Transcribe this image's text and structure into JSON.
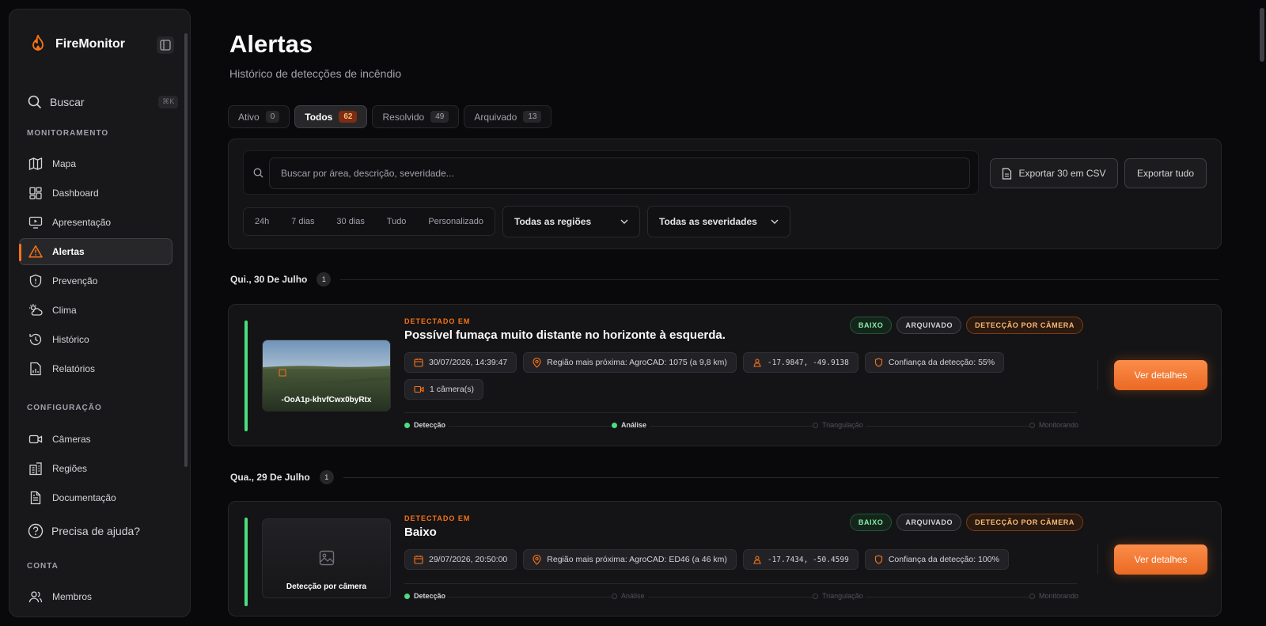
{
  "app": {
    "name": "FireMonitor"
  },
  "colors": {
    "accent": "#f97316",
    "success": "#4ade80",
    "background": "#09090b"
  },
  "sidebar": {
    "search": {
      "label": "Buscar",
      "shortcut": "⌘K"
    },
    "sections": {
      "monitoring": "MONITORAMENTO",
      "config": "CONFIGURAÇÃO",
      "account": "CONTA"
    },
    "monitoring_items": [
      {
        "label": "Mapa",
        "icon": "map-icon"
      },
      {
        "label": "Dashboard",
        "icon": "dashboard-icon"
      },
      {
        "label": "Apresentação",
        "icon": "presentation-icon"
      },
      {
        "label": "Alertas",
        "icon": "alert-triangle-icon",
        "active": true
      },
      {
        "label": "Prevenção",
        "icon": "shield-icon"
      },
      {
        "label": "Clima",
        "icon": "weather-icon"
      },
      {
        "label": "Histórico",
        "icon": "history-icon"
      },
      {
        "label": "Relatórios",
        "icon": "report-icon"
      }
    ],
    "config_items": [
      {
        "label": "Câmeras",
        "icon": "camera-icon"
      },
      {
        "label": "Regiões",
        "icon": "building-icon"
      },
      {
        "label": "Documentação",
        "icon": "document-icon"
      }
    ],
    "help": "Precisa de ajuda?",
    "account_items": [
      {
        "label": "Membros",
        "icon": "users-icon"
      }
    ]
  },
  "header": {
    "title": "Alertas",
    "subtitle": "Histórico de detecções de incêndio"
  },
  "tabs": [
    {
      "label": "Ativo",
      "count": "0"
    },
    {
      "label": "Todos",
      "count": "62",
      "active": true
    },
    {
      "label": "Resolvido",
      "count": "49"
    },
    {
      "label": "Arquivado",
      "count": "13"
    }
  ],
  "filters": {
    "search_placeholder": "Buscar por área, descrição, severidade...",
    "export_page": "Exportar 30 em CSV",
    "export_all": "Exportar tudo",
    "ranges": [
      "24h",
      "7 dias",
      "30 dias",
      "Tudo",
      "Personalizado"
    ],
    "region_select": "Todas as regiões",
    "severity_select": "Todas as severidades"
  },
  "groups": [
    {
      "date": "Qui., 30 De Julho",
      "count": "1",
      "alert": {
        "detected_label": "DETECTADO EM",
        "title": "Possível fumaça muito distante no horizonte à esquerda.",
        "badges": [
          "BAIXO",
          "ARQUIVADO",
          "DETECÇÃO POR CÂMERA"
        ],
        "thumb_label": "-OoA1p-khvfCwx0byRtx",
        "datetime": "30/07/2026, 14:39:47",
        "region": "Região mais próxima: AgroCAD: 1075 (a 9,8 km)",
        "coords": "-17.9847, -49.9138",
        "confidence": "Confiança da detecção: 55%",
        "cameras": "1 câmera(s)",
        "steps": [
          "Detecção",
          "Análise",
          "Triangulação",
          "Monitorando"
        ],
        "button": "Ver detalhes"
      }
    },
    {
      "date": "Qua., 29 De Julho",
      "count": "1",
      "alert": {
        "detected_label": "DETECTADO EM",
        "title": "Baixo",
        "badges": [
          "BAIXO",
          "ARQUIVADO",
          "DETECÇÃO POR CÂMERA"
        ],
        "thumb_label": "Detecção por câmera",
        "datetime": "29/07/2026, 20:50:00",
        "region": "Região mais próxima: AgroCAD: ED46 (a 46 km)",
        "coords": "-17.7434, -50.4599",
        "confidence": "Confiança da detecção: 100%",
        "steps": [
          "Detecção",
          "Análise",
          "Triangulação",
          "Monitorando"
        ],
        "button": "Ver detalhes"
      }
    }
  ]
}
